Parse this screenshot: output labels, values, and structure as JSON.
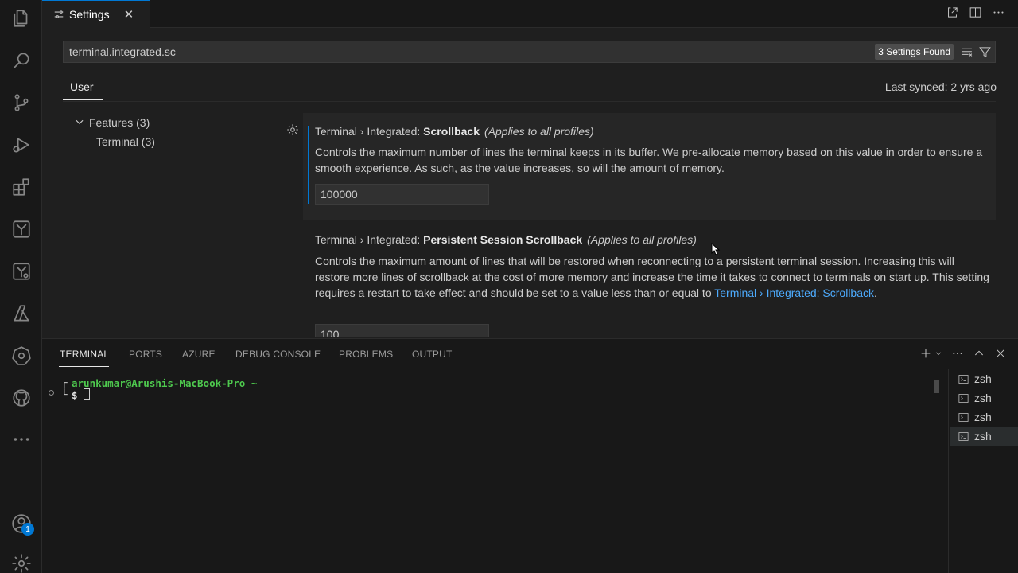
{
  "tab": {
    "title": "Settings",
    "close": "✕"
  },
  "search": {
    "value": "terminal.integrated.sc",
    "results": "3 Settings Found"
  },
  "scope": {
    "user": "User",
    "synced": "Last synced: 2 yrs ago"
  },
  "toc": {
    "features": "Features (3)",
    "terminal": "Terminal (3)"
  },
  "settings": [
    {
      "prefix": "Terminal › Integrated: ",
      "name": "Scrollback",
      "scope": "(Applies to all profiles)",
      "description": "Controls the maximum number of lines the terminal keeps in its buffer. We pre-allocate memory based on this value in order to ensure a smooth experience. As such, as the value increases, so will the amount of memory.",
      "value": "100000"
    },
    {
      "prefix": "Terminal › Integrated: ",
      "name": "Persistent Session Scrollback",
      "scope": "(Applies to all profiles)",
      "description": "Controls the maximum amount of lines that will be restored when reconnecting to a persistent terminal session. Increasing this will restore more lines of scrollback at the cost of more memory and increase the time it takes to connect to terminals on start up. This setting requires a restart to take effect and should be set to a value less than or equal to ",
      "link": "Terminal › Integrated: Scrollback",
      "description_end": ".",
      "value": "100"
    }
  ],
  "panel": {
    "tabs": [
      "TERMINAL",
      "PORTS",
      "AZURE",
      "DEBUG CONSOLE",
      "PROBLEMS",
      "OUTPUT"
    ],
    "user_host": "arunkumar@Arushis-MacBook-Pro ~",
    "prompt": "$",
    "terminals": [
      "zsh",
      "zsh",
      "zsh",
      "zsh"
    ]
  },
  "accounts_badge": "1"
}
